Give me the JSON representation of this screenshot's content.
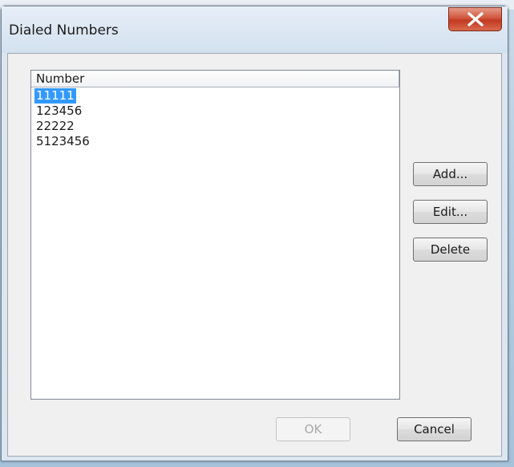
{
  "dialog": {
    "title": "Dialed Numbers"
  },
  "list": {
    "column_header": "Number",
    "rows": [
      "11111",
      "123456",
      "22222",
      "5123456"
    ],
    "selected_index": 0
  },
  "buttons": {
    "add": "Add...",
    "edit": "Edit...",
    "delete": "Delete",
    "ok": "OK",
    "cancel": "Cancel"
  },
  "colors": {
    "selection": "#3399ff",
    "close_button": "#c23a20"
  }
}
